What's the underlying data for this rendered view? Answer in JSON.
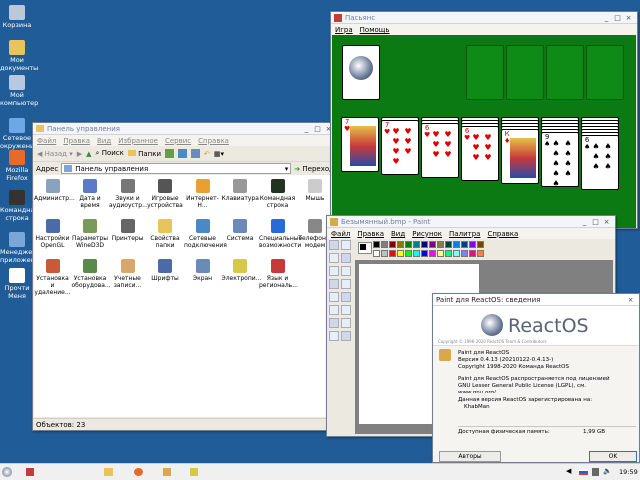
{
  "desktop": {
    "icons": [
      {
        "label": "Корзина",
        "color": "#bcc8d8"
      },
      {
        "label": "Мои документы",
        "color": "#e8c45a"
      },
      {
        "label": "Мой компьютер",
        "color": "#b8c8e0"
      },
      {
        "label": "Сетевое окружение",
        "color": "#6aa8e6"
      },
      {
        "label": "Mozilla Firefox",
        "color": "#e66a2a"
      },
      {
        "label": "Командная строка",
        "color": "#333333"
      },
      {
        "label": "Менеджер приложений",
        "color": "#7aa6d8"
      },
      {
        "label": "Прочти Меня",
        "color": "#ffffff"
      }
    ]
  },
  "cpanel": {
    "title": "Панель управления",
    "menu": [
      "Файл",
      "Правка",
      "Вид",
      "Избранное",
      "Сервис",
      "Справка"
    ],
    "back": "Назад",
    "search": "Поиск",
    "folders": "Папки",
    "address_label": "Адрес",
    "address_value": "Панель управления",
    "go": "Переход",
    "items": [
      {
        "label": "Администр...",
        "color": "#8aa2c0"
      },
      {
        "label": "Дата и время",
        "color": "#5a7cc8"
      },
      {
        "label": "Звуки и аудиоустр...",
        "color": "#777777"
      },
      {
        "label": "Игровые устройства",
        "color": "#555555"
      },
      {
        "label": "Интернет-Н...",
        "color": "#e8a030"
      },
      {
        "label": "Клавиатура",
        "color": "#999999"
      },
      {
        "label": "Командная строка",
        "color": "#223322"
      },
      {
        "label": "Мышь",
        "color": "#cccccc"
      },
      {
        "label": "Настройки OpenGL",
        "color": "#4a6aa8"
      },
      {
        "label": "Параметры WineD3D",
        "color": "#7a9a5a"
      },
      {
        "label": "Принтеры",
        "color": "#666666"
      },
      {
        "label": "Свойства папки",
        "color": "#e8c45a"
      },
      {
        "label": "Сетевые подключения",
        "color": "#4a88c8"
      },
      {
        "label": "Система",
        "color": "#6a8ab8"
      },
      {
        "label": "Специальные возможности",
        "color": "#2a6ad8"
      },
      {
        "label": "Телефон и модем",
        "color": "#888888"
      },
      {
        "label": "Установка и удаление...",
        "color": "#c85a3a"
      },
      {
        "label": "Установка оборудова...",
        "color": "#5a8a4a"
      },
      {
        "label": "Учетные записи...",
        "color": "#d8a86a"
      },
      {
        "label": "Шрифты",
        "color": "#4a6aa8"
      },
      {
        "label": "Экран",
        "color": "#6a8ab8"
      },
      {
        "label": "Электропи...",
        "color": "#d8c84a"
      },
      {
        "label": "Язык и региональ...",
        "color": "#c83a3a"
      }
    ],
    "status": "Объектов: 23"
  },
  "solitaire": {
    "title": "Пасьянс",
    "menu": [
      "Игра",
      "Помощь"
    ],
    "tableau": [
      {
        "rank": "7",
        "suit": "♥",
        "color": "red",
        "face": true
      },
      {
        "rank": "7",
        "suit": "♥",
        "color": "red"
      },
      {
        "rank": "6",
        "suit": "♥",
        "color": "red"
      },
      {
        "rank": "6",
        "suit": "♥",
        "color": "red"
      },
      {
        "rank": "К",
        "suit": "♦",
        "color": "red",
        "face": true
      },
      {
        "rank": "9",
        "suit": "♠",
        "color": "black"
      },
      {
        "rank": "6",
        "suit": "♠",
        "color": "black"
      }
    ]
  },
  "paint": {
    "title": "Безымянный.bmp - Paint",
    "menu": [
      "Файл",
      "Правка",
      "Вид",
      "Рисунок",
      "Палитра",
      "Справка"
    ],
    "palette": [
      "#000000",
      "#808080",
      "#800000",
      "#808000",
      "#008000",
      "#008080",
      "#000080",
      "#800080",
      "#808040",
      "#004040",
      "#0080ff",
      "#004080",
      "#8000ff",
      "#804000",
      "#ffffff",
      "#c0c0c0",
      "#ff0000",
      "#ffff00",
      "#00ff00",
      "#00ffff",
      "#0000ff",
      "#ff00ff",
      "#ffff80",
      "#00ff80",
      "#80ffff",
      "#8080ff",
      "#ff0080",
      "#ff8040"
    ]
  },
  "about": {
    "title": "Paint для ReactOS: сведения",
    "logo": "ReactOS",
    "copyright_banner": "Copyright © 1996-2020 ReactOS Team & Contributors",
    "app": "Paint для ReactOS",
    "version": "Версия 0.4.13   (20210122-0.4.13-)",
    "copyright": "Copyright 1998-2020 Команда ReactOS",
    "license1": "Paint для ReactOS распространяется под лицензией",
    "license2": "GNU Lesser General Public License (LGPL), см.",
    "license3": "www.gnu.org/",
    "registered": "Данная версия ReactOS зарегистрирована на:",
    "user": "KhabMan",
    "memory_label": "Доступная физическая память:",
    "memory_value": "1,99 GB",
    "authors": "Авторы",
    "ok": "OK"
  },
  "taskbar": {
    "clock": "19:59"
  }
}
